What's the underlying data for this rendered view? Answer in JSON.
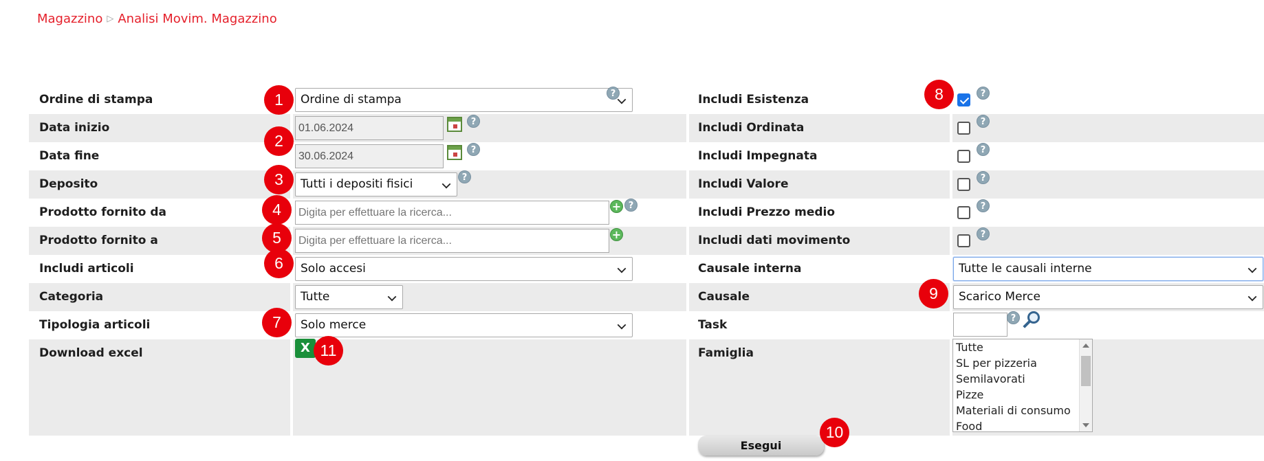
{
  "breadcrumb": {
    "parent": "Magazzino",
    "separator": "▷",
    "current": "Analisi Movim. Magazzino"
  },
  "left": {
    "print_order": {
      "label": "Ordine di stampa",
      "value": "Ordine di stampa"
    },
    "start_date": {
      "label": "Data inizio",
      "value": "01.06.2024"
    },
    "end_date": {
      "label": "Data fine",
      "value": "30.06.2024"
    },
    "warehouse": {
      "label": "Deposito",
      "value": "Tutti i depositi fisici"
    },
    "product_from": {
      "label": "Prodotto fornito da",
      "placeholder": "Digita per effettuare la ricerca..."
    },
    "product_to": {
      "label": "Prodotto fornito a",
      "placeholder": "Digita per effettuare la ricerca..."
    },
    "include_items": {
      "label": "Includi articoli",
      "value": "Solo accesi"
    },
    "category": {
      "label": "Categoria",
      "value": "Tutte"
    },
    "item_type": {
      "label": "Tipologia articoli",
      "value": "Solo merce"
    },
    "download_excel": {
      "label": "Download excel",
      "icon": "excel-icon"
    }
  },
  "right": {
    "include_stock": {
      "label": "Includi Esistenza",
      "checked": true
    },
    "include_ordered": {
      "label": "Includi Ordinata",
      "checked": false
    },
    "include_committed": {
      "label": "Includi Impegnata",
      "checked": false
    },
    "include_value": {
      "label": "Includi Valore",
      "checked": false
    },
    "include_avg_price": {
      "label": "Includi Prezzo medio",
      "checked": false
    },
    "include_movement_data": {
      "label": "Includi dati movimento",
      "checked": false
    },
    "internal_reason": {
      "label": "Causale interna",
      "value": "Tutte le causali interne"
    },
    "reason": {
      "label": "Causale",
      "value": "Scarico Merce"
    },
    "task": {
      "label": "Task",
      "value": ""
    },
    "family": {
      "label": "Famiglia",
      "options": [
        "Tutte",
        "SL per pizzeria",
        "Semilavorati",
        "Pizze",
        "Materiali di consumo",
        "Food"
      ]
    }
  },
  "run_button": {
    "label": "Esegui"
  },
  "help_glyph": "?",
  "plus_glyph": "+",
  "excel_glyph": "X",
  "badges": [
    "1",
    "2",
    "3",
    "4",
    "5",
    "6",
    "7",
    "8",
    "9",
    "10",
    "11"
  ],
  "colors": {
    "accent": "#e5202b",
    "badge": "#e8000b",
    "row_shade": "#ebebeb",
    "checkbox_checked": "#1a73e8"
  }
}
